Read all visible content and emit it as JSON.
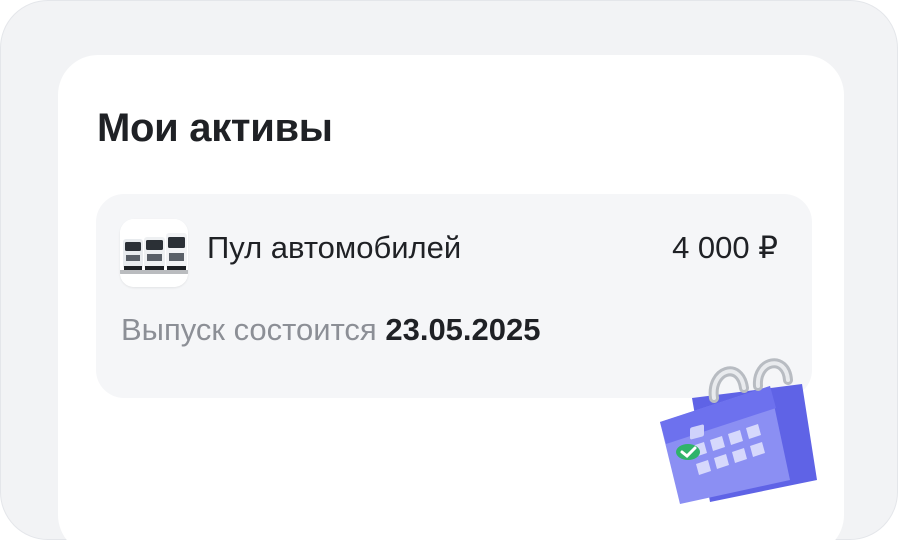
{
  "section": {
    "title": "Мои активы"
  },
  "asset": {
    "name": "Пул автомобилей",
    "amount": "4 000 ₽",
    "icon": "trucks-icon",
    "release_label": "Выпуск состоится",
    "release_date": "23.05.2025"
  },
  "decoration": {
    "icon": "calendar-icon"
  }
}
